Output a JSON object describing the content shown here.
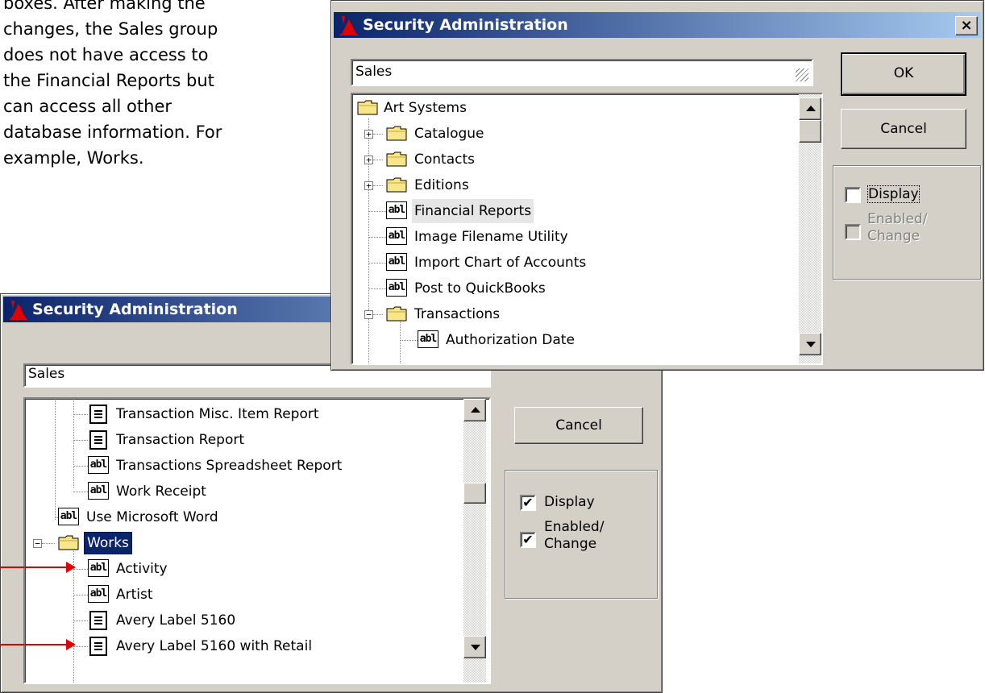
{
  "caption": {
    "lines": [
      "boxes. After making the",
      "changes, the Sales group",
      "does not have access to",
      "the Financial Reports but",
      "can access all other",
      "database information. For",
      "example, Works."
    ]
  },
  "dialog_front": {
    "title": "Security Administration",
    "close_glyph": "×",
    "group_field": "Sales",
    "tree_items": [
      {
        "label": "Art Systems",
        "icon": "folder-icon",
        "expander": ""
      },
      {
        "label": "Catalogue",
        "icon": "folder-icon",
        "expander": "+"
      },
      {
        "label": "Contacts",
        "icon": "folder-icon",
        "expander": "+"
      },
      {
        "label": "Editions",
        "icon": "folder-icon",
        "expander": "+"
      },
      {
        "label": "Financial Reports",
        "icon": "form-icon",
        "expander": ""
      },
      {
        "label": "Image Filename Utility",
        "icon": "form-icon",
        "expander": ""
      },
      {
        "label": "Import Chart of Accounts",
        "icon": "form-icon",
        "expander": ""
      },
      {
        "label": "Post to QuickBooks",
        "icon": "form-icon",
        "expander": ""
      },
      {
        "label": "Transactions",
        "icon": "folder-icon",
        "expander": "−"
      },
      {
        "label": "Authorization Date",
        "icon": "form-icon",
        "expander": ""
      }
    ],
    "ok_label": "OK",
    "cancel_label": "Cancel",
    "display_label": "Display",
    "display_checked": false,
    "enabled_label_1": "Enabled/",
    "enabled_label_2": "Change",
    "enabled_checked": false,
    "form_icon_text": "abl"
  },
  "dialog_back": {
    "title": "Security Administration",
    "group_field": "Sales",
    "tree_items": [
      {
        "label": "Transaction Misc. Item Report",
        "icon": "report-icon"
      },
      {
        "label": "Transaction Report",
        "icon": "report-icon"
      },
      {
        "label": "Transactions Spreadsheet Report",
        "icon": "form-icon"
      },
      {
        "label": "Work Receipt",
        "icon": "form-icon"
      },
      {
        "label": "Use Microsoft Word",
        "icon": "form-icon"
      },
      {
        "label": "Works",
        "icon": "folder-icon",
        "expander": "−"
      },
      {
        "label": "Activity",
        "icon": "form-icon"
      },
      {
        "label": "Artist",
        "icon": "form-icon"
      },
      {
        "label": "Avery Label 5160",
        "icon": "report-icon"
      },
      {
        "label": "Avery Label 5160 with Retail",
        "icon": "report-icon"
      }
    ],
    "cancel_label": "Cancel",
    "display_label": "Display",
    "display_checked": true,
    "enabled_label_1": "Enabled/",
    "enabled_label_2": "Change",
    "enabled_checked": true,
    "check_glyph": "✔",
    "form_icon_text": "abl"
  },
  "colors": {
    "annotation_arrow": "#e00000",
    "titlebar_start": "#0a246a",
    "titlebar_end": "#a6caf0",
    "dialog_face": "#d4d0c8"
  }
}
